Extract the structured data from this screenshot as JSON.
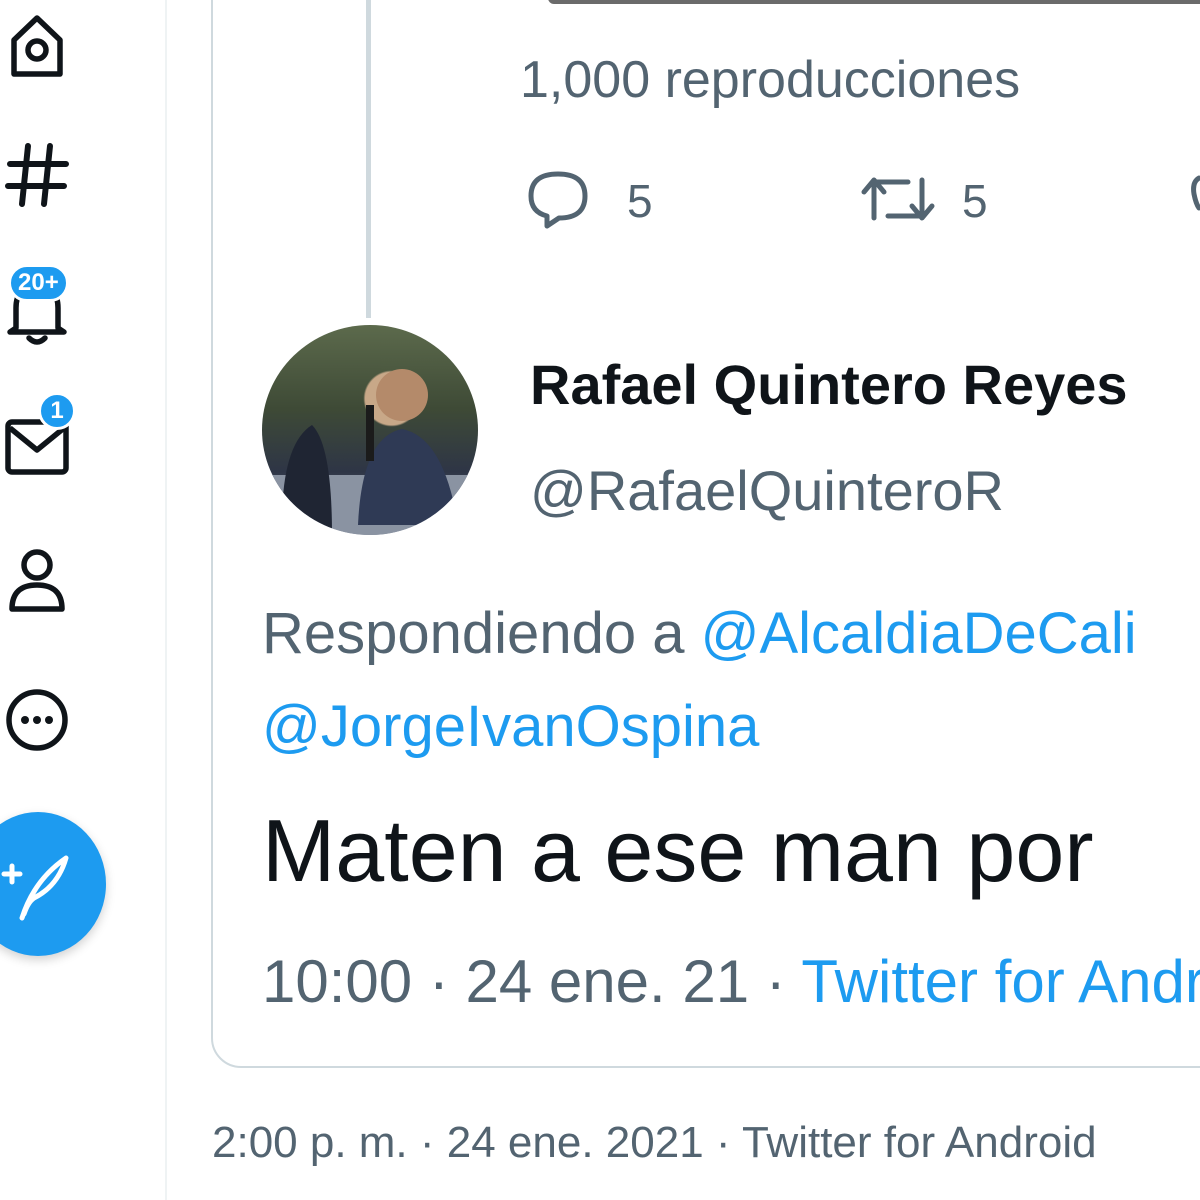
{
  "nav": {
    "items": [
      {
        "name": "home",
        "icon": "home-icon"
      },
      {
        "name": "explore",
        "icon": "hashtag-icon"
      },
      {
        "name": "notifications",
        "icon": "bell-icon",
        "badge": "20+"
      },
      {
        "name": "messages",
        "icon": "envelope-icon",
        "badge": "1"
      },
      {
        "name": "profile",
        "icon": "person-icon"
      },
      {
        "name": "more",
        "icon": "more-icon"
      }
    ],
    "compose_icon": "feather-plus-icon"
  },
  "quoted_tweet": {
    "views": "1,000 reproducciones",
    "reply_count": "5",
    "retweet_count": "5",
    "reply": {
      "display_name": "Rafael Quintero Reyes",
      "handle": "@RafaelQuinteroR",
      "replying_label": "Respondiendo a ",
      "replying_to": "@AlcaldiaDeCali",
      "replying_to_2": "@JorgeIvanOspina",
      "text": "Maten a ese man por",
      "time": "10:00",
      "separator": " · ",
      "date": "24 ene. 21",
      "source": "Twitter for Android"
    }
  },
  "outer_tweet": {
    "meta": "2:00 p. m. · 24 ene. 2021 · Twitter for Android"
  },
  "colors": {
    "accent": "#1d9bf0",
    "secondary_text": "#536471",
    "primary_text": "#0f1419",
    "border": "#cfd9de"
  }
}
